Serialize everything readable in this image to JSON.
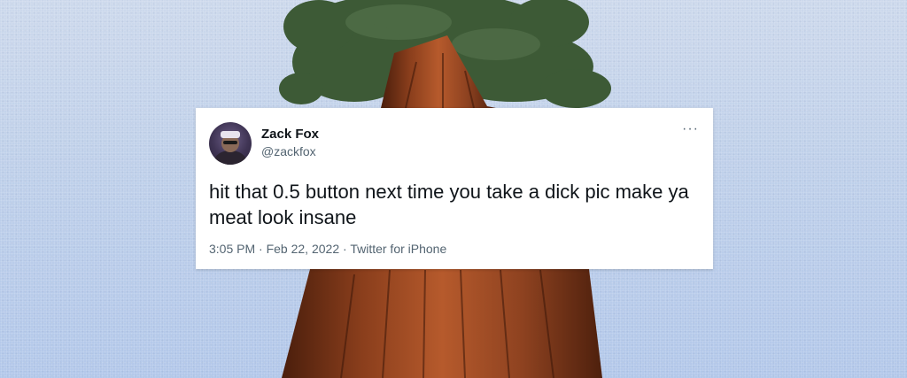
{
  "tweet": {
    "display_name": "Zack Fox",
    "handle": "@zackfox",
    "more_icon": "···",
    "text": "hit that 0.5 button next time you take a dick pic make ya meat look insane",
    "time": "3:05 PM",
    "separator": " · ",
    "date": "Feb 22, 2022",
    "source": "Twitter for iPhone"
  },
  "colors": {
    "sky_top": "#cdd9ec",
    "sky_bottom": "#b3c8ea",
    "bark": "#8a3e1c",
    "foliage": "#3d5a36",
    "text_primary": "#0f1419",
    "text_secondary": "#536471"
  }
}
